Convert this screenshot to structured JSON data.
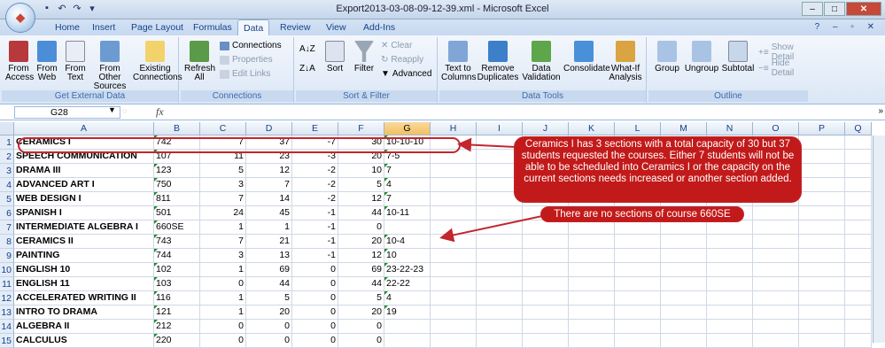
{
  "window": {
    "title": "Export2013-03-08-09-12-39.xml - Microsoft Excel",
    "controls": [
      "–",
      "□",
      "✕"
    ]
  },
  "tabs": [
    "Home",
    "Insert",
    "Page Layout",
    "Formulas",
    "Data",
    "Review",
    "View",
    "Add-Ins"
  ],
  "active_tab": "Data",
  "ribbon": {
    "get_external": {
      "label": "Get External Data",
      "buttons": [
        "From Access",
        "From Web",
        "From Text",
        "From Other Sources",
        "Existing Connections"
      ]
    },
    "connections": {
      "label": "Connections",
      "refresh": "Refresh All",
      "items": [
        "Connections",
        "Properties",
        "Edit Links"
      ]
    },
    "sort_filter": {
      "label": "Sort & Filter",
      "sort": "Sort",
      "filter": "Filter",
      "items": [
        "Clear",
        "Reapply",
        "Advanced"
      ]
    },
    "data_tools": {
      "label": "Data Tools",
      "buttons": [
        "Text to Columns",
        "Remove Duplicates",
        "Data Validation",
        "Consolidate",
        "What-If Analysis"
      ]
    },
    "outline": {
      "label": "Outline",
      "buttons": [
        "Group",
        "Ungroup",
        "Subtotal"
      ],
      "items": [
        "Show Detail",
        "Hide Detail"
      ]
    }
  },
  "formula_bar": {
    "name_box": "G28",
    "fx": "fx",
    "value": ""
  },
  "columns": [
    "A",
    "B",
    "C",
    "D",
    "E",
    "F",
    "G",
    "H",
    "I",
    "J",
    "K",
    "L",
    "M",
    "N",
    "O",
    "P",
    "Q"
  ],
  "selected_column": "G",
  "rows": [
    {
      "n": "1",
      "a": "CERAMICS I",
      "b": "742",
      "c": "7",
      "d": "37",
      "e": "-7",
      "f": "30",
      "g": "10-10-10"
    },
    {
      "n": "2",
      "a": "SPEECH COMMUNICATION",
      "b": "107",
      "c": "11",
      "d": "23",
      "e": "-3",
      "f": "20",
      "g": "7-5"
    },
    {
      "n": "3",
      "a": "DRAMA III",
      "b": "123",
      "c": "5",
      "d": "12",
      "e": "-2",
      "f": "10",
      "g": "7"
    },
    {
      "n": "4",
      "a": "ADVANCED ART I",
      "b": "750",
      "c": "3",
      "d": "7",
      "e": "-2",
      "f": "5",
      "g": "4"
    },
    {
      "n": "5",
      "a": "WEB DESIGN I",
      "b": "811",
      "c": "7",
      "d": "14",
      "e": "-2",
      "f": "12",
      "g": "7"
    },
    {
      "n": "6",
      "a": "SPANISH I",
      "b": "501",
      "c": "24",
      "d": "45",
      "e": "-1",
      "f": "44",
      "g": "10-11"
    },
    {
      "n": "7",
      "a": "INTERMEDIATE ALGEBRA I",
      "b": "660SE",
      "c": "1",
      "d": "1",
      "e": "-1",
      "f": "0",
      "g": ""
    },
    {
      "n": "8",
      "a": "CERAMICS II",
      "b": "743",
      "c": "7",
      "d": "21",
      "e": "-1",
      "f": "20",
      "g": "10-4"
    },
    {
      "n": "9",
      "a": "PAINTING",
      "b": "744",
      "c": "3",
      "d": "13",
      "e": "-1",
      "f": "12",
      "g": "10"
    },
    {
      "n": "10",
      "a": "ENGLISH 10",
      "b": "102",
      "c": "1",
      "d": "69",
      "e": "0",
      "f": "69",
      "g": "23-22-23"
    },
    {
      "n": "11",
      "a": "ENGLISH 11",
      "b": "103",
      "c": "0",
      "d": "44",
      "e": "0",
      "f": "44",
      "g": "22-22"
    },
    {
      "n": "12",
      "a": "ACCELERATED WRITING II",
      "b": "116",
      "c": "1",
      "d": "5",
      "e": "0",
      "f": "5",
      "g": "4"
    },
    {
      "n": "13",
      "a": "INTRO TO DRAMA",
      "b": "121",
      "c": "1",
      "d": "20",
      "e": "0",
      "f": "20",
      "g": "19"
    },
    {
      "n": "14",
      "a": "ALGEBRA II",
      "b": "212",
      "c": "0",
      "d": "0",
      "e": "0",
      "f": "0",
      "g": ""
    },
    {
      "n": "15",
      "a": "CALCULUS",
      "b": "220",
      "c": "0",
      "d": "0",
      "e": "0",
      "f": "0",
      "g": ""
    }
  ],
  "callouts": {
    "capacity": "Ceramics I has 3 sections with a total capacity of 30 but 37 students requested the courses. Either 7 students will not be able to be scheduled into Ceramics I or the capacity on the current sections needs increased or another section added.",
    "no_sections": "There are no sections of course 660SE"
  },
  "colors": {
    "callout": "#c21a1a",
    "accent": "#15428b"
  }
}
